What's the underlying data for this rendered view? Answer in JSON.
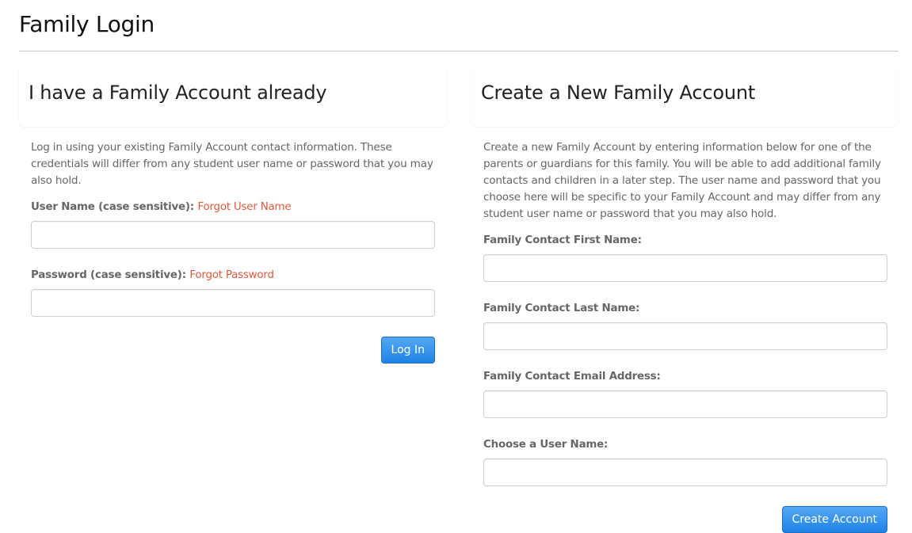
{
  "page": {
    "title": "Family Login"
  },
  "login": {
    "heading": "I have a Family Account already",
    "intro": "Log in using your existing Family Account contact information. These credentials will differ from any student user name or password that you may also hold.",
    "username_label": "User Name (case sensitive):",
    "forgot_username": "Forgot User Name",
    "username_value": "",
    "password_label": "Password (case sensitive):",
    "forgot_password": "Forgot Password",
    "password_value": "",
    "submit_label": "Log In"
  },
  "create": {
    "heading": "Create a New Family Account",
    "intro": "Create a new Family Account by entering information below for one of the parents or guardians for this family. You will be able to add additional family contacts and children in a later step. The user name and password that you choose here will be specific to your Family Account and may differ from any student user name or password that you may also hold.",
    "fields": [
      {
        "label": "Family Contact First Name:",
        "value": ""
      },
      {
        "label": "Family Contact Last Name:",
        "value": ""
      },
      {
        "label": "Family Contact Email Address:",
        "value": ""
      },
      {
        "label": "Choose a User Name:",
        "value": ""
      }
    ],
    "submit_label": "Create Account"
  },
  "colors": {
    "link": "#e2583e",
    "primary_button": "#1f83e5"
  }
}
